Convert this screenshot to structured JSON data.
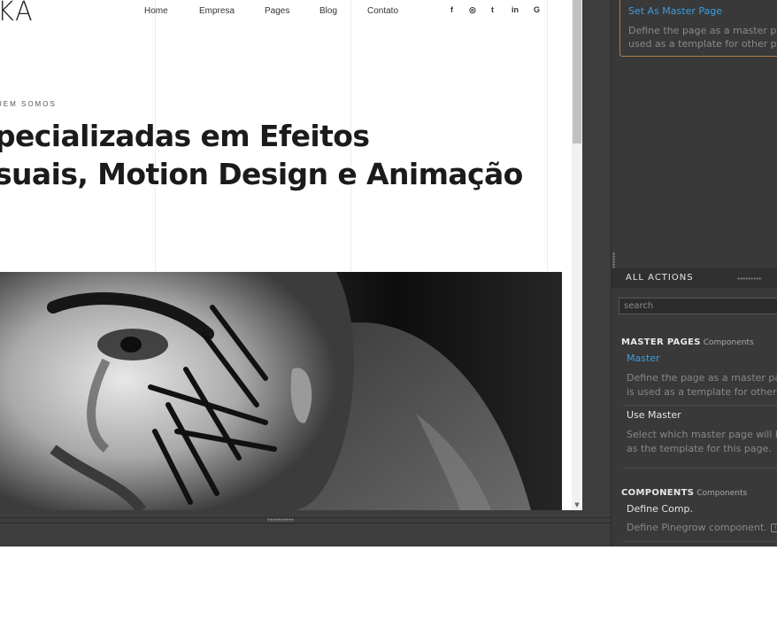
{
  "site": {
    "logo": "KA",
    "nav": [
      "Home",
      "Empresa",
      "Pages",
      "Blog",
      "Contato"
    ],
    "social_icons": [
      "facebook-icon",
      "instagram-icon",
      "twitter-icon",
      "linkedin-icon",
      "google-icon"
    ],
    "social_glyphs": [
      "f",
      "◎",
      "t",
      "in",
      "G"
    ],
    "kicker": "UEM SOMOS",
    "headline_line1": "pecializadas em Efeitos",
    "headline_line2": "suais, Motion Design e Animação"
  },
  "panel": {
    "master_card": {
      "title": "Set As Master Page",
      "desc_line1": "Define the page as a master page",
      "desc_line2": "used as a template for other page"
    },
    "all_actions": {
      "header": "ALL ACTIONS",
      "search_placeholder": "search"
    },
    "sections": [
      {
        "name": "MASTER PAGES",
        "sub": "Components",
        "items": [
          {
            "title": "Master",
            "desc_line1": "Define the page as a master page",
            "desc_line2": "is used as a template for other pa"
          },
          {
            "title": "Use Master",
            "desc_line1": "Select which master page will be u",
            "desc_line2": "as the template for this page."
          }
        ]
      },
      {
        "name": "COMPONENTS",
        "sub": "Components",
        "items": [
          {
            "title": "Define Comp.",
            "desc_line1": "Define Pinegrow component."
          }
        ]
      }
    ]
  },
  "colors": {
    "accent_link": "#3d9be0",
    "card_border": "#b0804a",
    "panel_bg": "#393939"
  }
}
